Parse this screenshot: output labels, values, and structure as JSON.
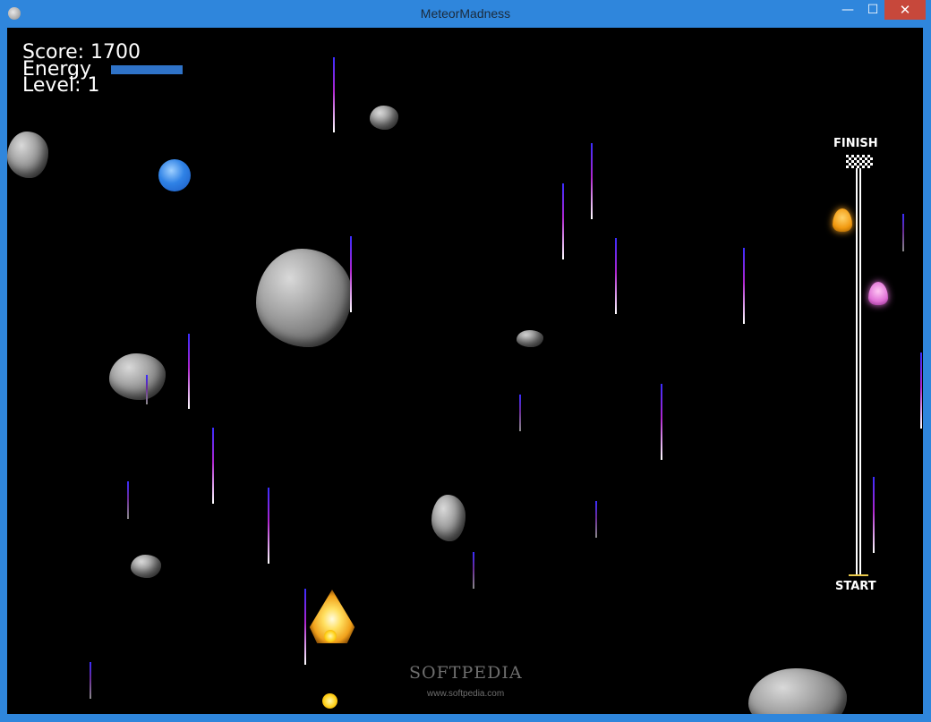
{
  "window": {
    "title": "MeteorMadness",
    "minimize_glyph": "—",
    "maximize_glyph": "☐",
    "close_glyph": "✕"
  },
  "hud": {
    "score_text": "Score: 1700",
    "energy_label": "Energy",
    "energy_level": 0.8,
    "level_text": "Level: 1"
  },
  "progress_track": {
    "finish_label": "FINISH",
    "start_label": "START"
  },
  "watermark": {
    "brand": "SOFTPEDIA",
    "url": "www.softpedia.com"
  },
  "colors": {
    "window_frame": "#2f86dc",
    "background": "#000000",
    "energy_bar": "#2f73c8",
    "close_button": "#c7483b",
    "ship_glow": "#f0a01a",
    "orb": "#2f82e6"
  }
}
